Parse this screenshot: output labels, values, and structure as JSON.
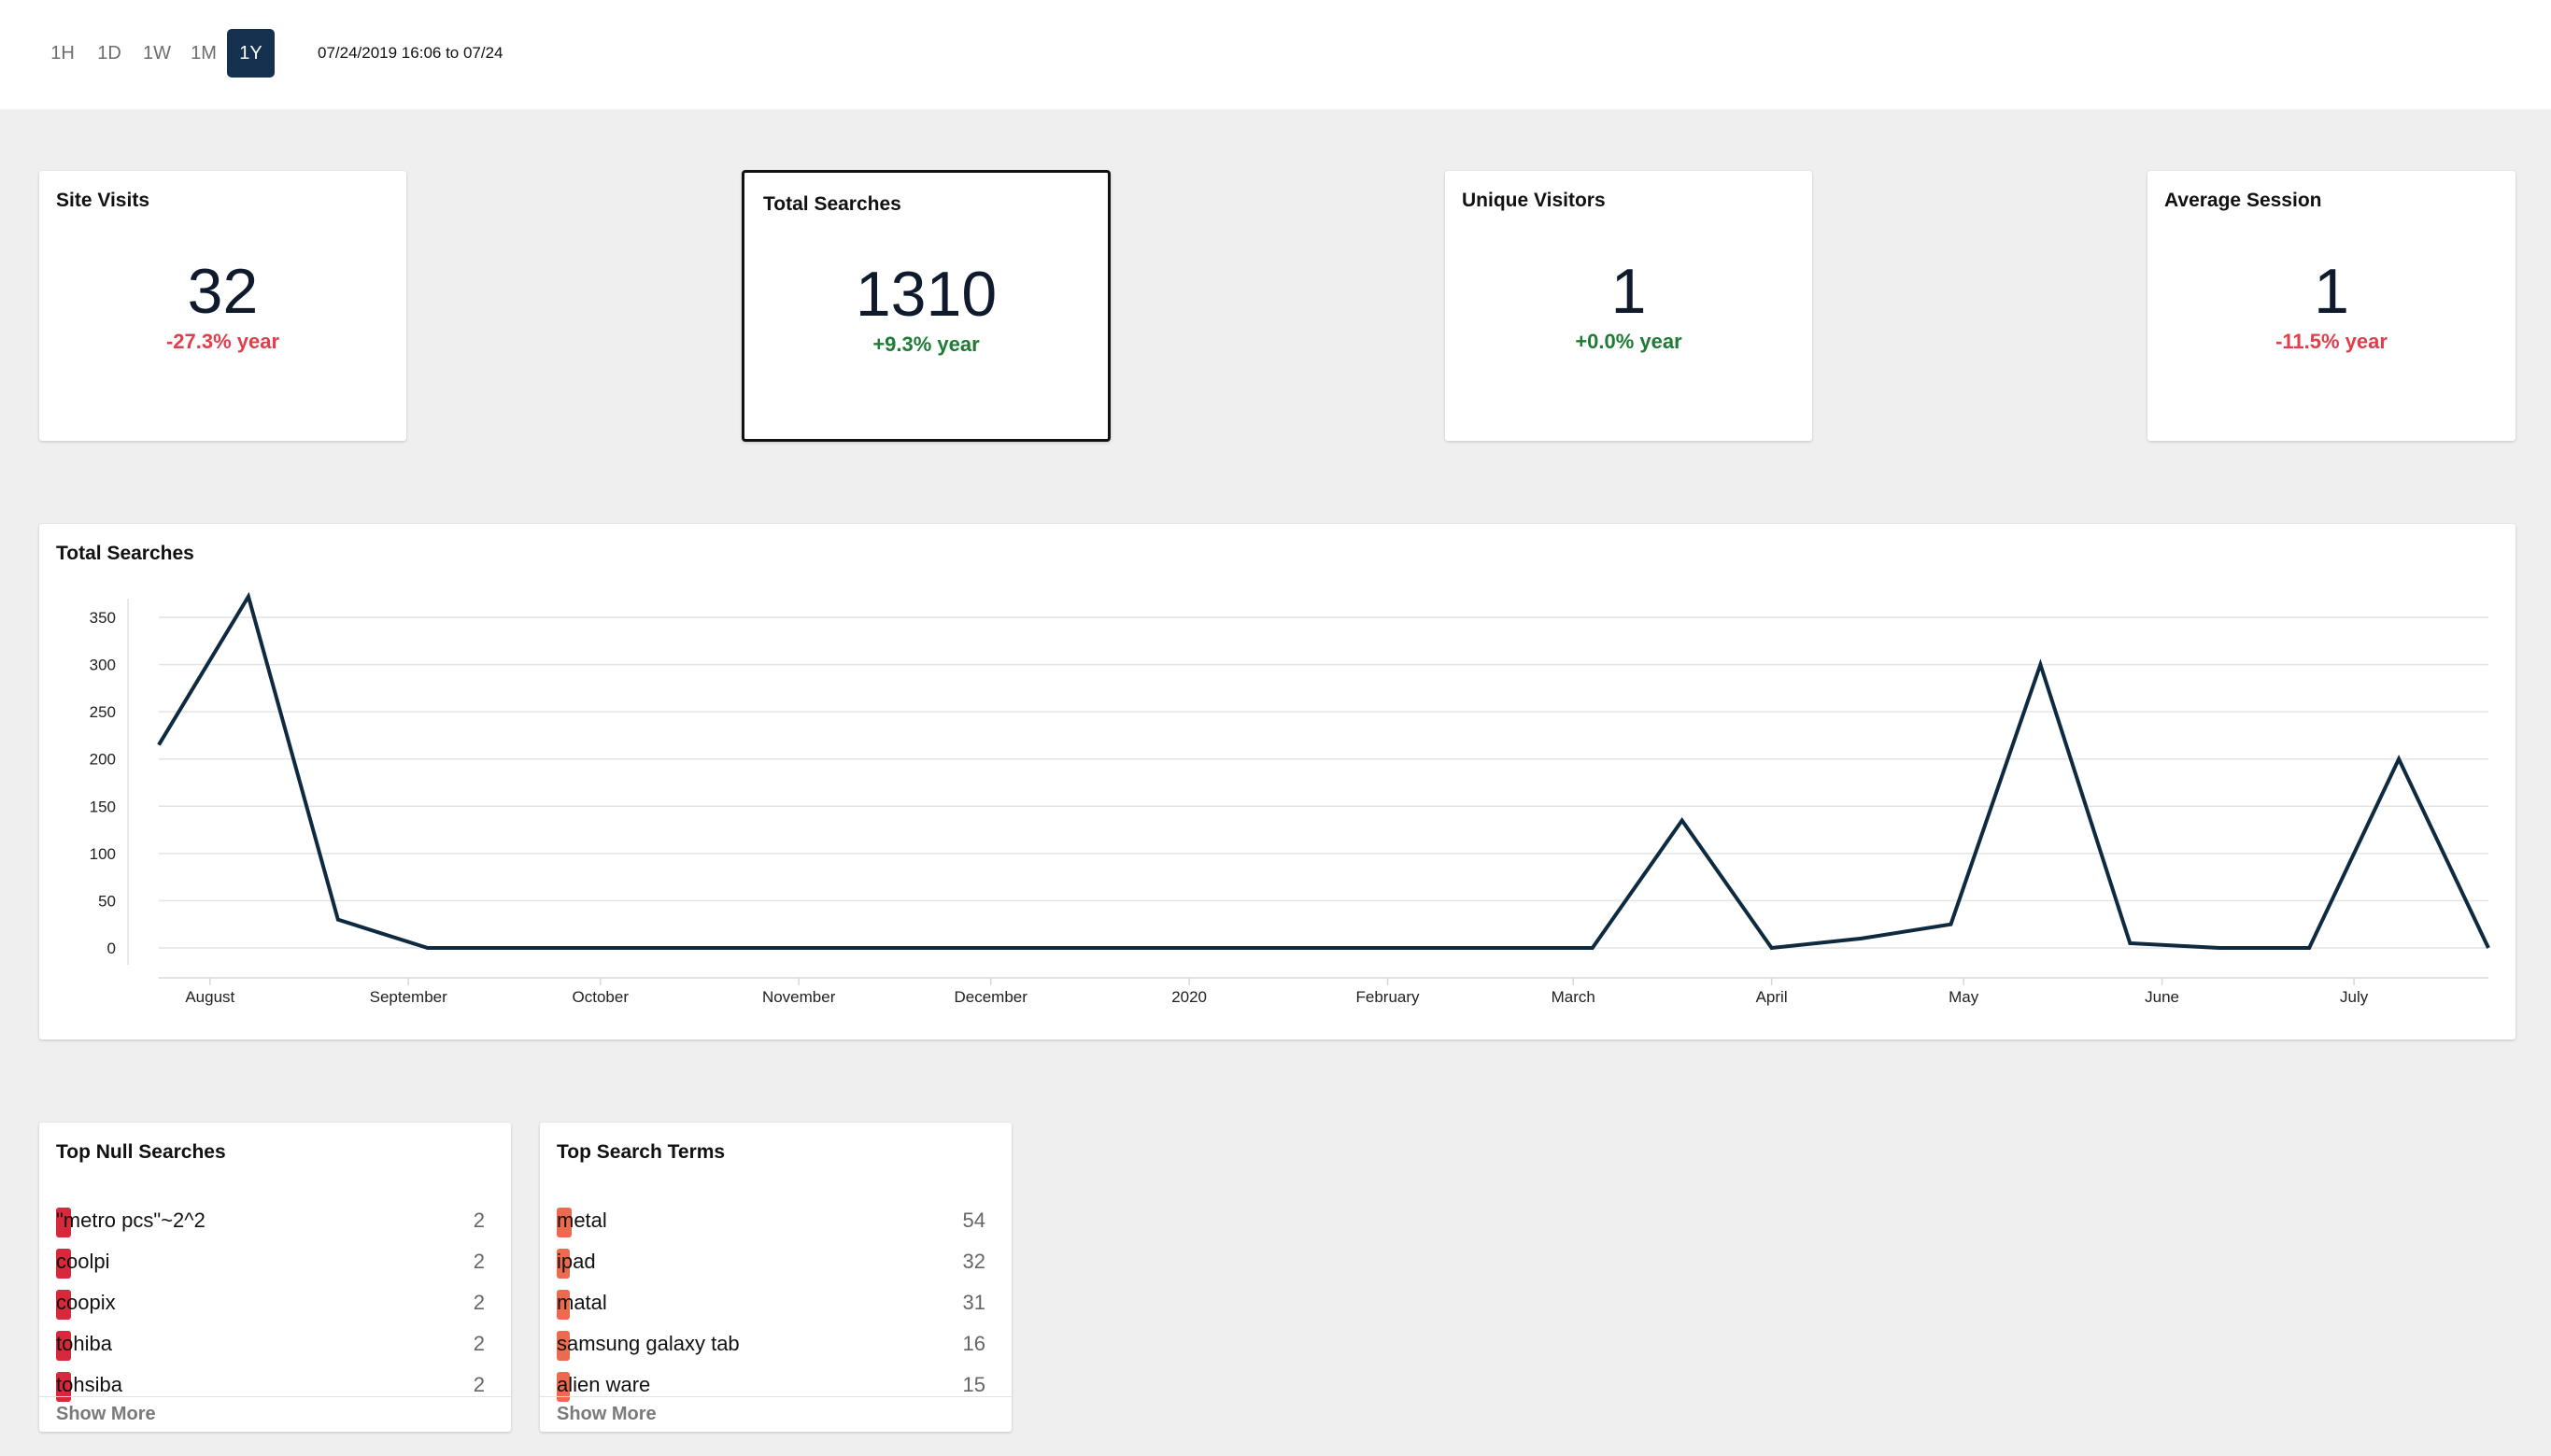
{
  "time_range": {
    "buttons": [
      "1H",
      "1D",
      "1W",
      "1M",
      "1Y"
    ],
    "active": "1Y",
    "date_text": "07/24/2019 16:06 to 07/24"
  },
  "stats": [
    {
      "title": "Site Visits",
      "value": "32",
      "change": "-27.3% year",
      "trend": "down"
    },
    {
      "title": "Total Searches",
      "value": "1310",
      "change": "+9.3% year",
      "trend": "up"
    },
    {
      "title": "Unique Visitors",
      "value": "1",
      "change": "+0.0% year",
      "trend": "up"
    },
    {
      "title": "Average Session",
      "value": "1",
      "change": "-11.5% year",
      "trend": "down"
    }
  ],
  "colors": {
    "active_button": "#15314f",
    "negative": "#e23d4b",
    "positive": "#1e7b34",
    "line": "#0d2a40",
    "null_bar": "#d8283b",
    "term_bar": "#ec6a4e"
  },
  "chart_data": {
    "type": "line",
    "title": "Total Searches",
    "xlabel": "",
    "ylabel": "",
    "x_ticks": [
      "August",
      "September",
      "October",
      "November",
      "December",
      "2020",
      "February",
      "March",
      "April",
      "May",
      "June",
      "July"
    ],
    "y_ticks": [
      0,
      50,
      100,
      150,
      200,
      250,
      300,
      350
    ],
    "ylim": [
      0,
      370
    ],
    "grid": true,
    "x": [
      "2019-07-24",
      "2019-08-07",
      "2019-08-21",
      "2019-09-04",
      "2019-09-18",
      "2019-10-02",
      "2019-10-16",
      "2019-10-30",
      "2019-11-13",
      "2019-11-27",
      "2019-12-11",
      "2019-12-25",
      "2020-01-08",
      "2020-01-22",
      "2020-02-05",
      "2020-02-19",
      "2020-03-04",
      "2020-03-18",
      "2020-04-01",
      "2020-04-15",
      "2020-04-29",
      "2020-05-13",
      "2020-05-27",
      "2020-06-10",
      "2020-06-24",
      "2020-07-08",
      "2020-07-22"
    ],
    "series": [
      {
        "values": [
          215,
          372,
          30,
          0,
          0,
          0,
          0,
          0,
          0,
          0,
          0,
          0,
          0,
          0,
          0,
          0,
          0,
          135,
          0,
          10,
          25,
          300,
          5,
          0,
          0,
          200,
          0,
          23
        ]
      }
    ]
  },
  "top_null_searches": {
    "title": "Top Null Searches",
    "items": [
      {
        "label": "\"metro pcs\"~2^2",
        "count": "2"
      },
      {
        "label": "coolpi",
        "count": "2"
      },
      {
        "label": "coopix",
        "count": "2"
      },
      {
        "label": "tohiba",
        "count": "2"
      },
      {
        "label": "tohsiba",
        "count": "2"
      }
    ],
    "show_more": "Show More"
  },
  "top_search_terms": {
    "title": "Top Search Terms",
    "items": [
      {
        "label": "metal",
        "count": "54"
      },
      {
        "label": "ipad",
        "count": "32"
      },
      {
        "label": "matal",
        "count": "31"
      },
      {
        "label": "samsung galaxy tab",
        "count": "16"
      },
      {
        "label": "alien ware",
        "count": "15"
      }
    ],
    "show_more": "Show More"
  }
}
